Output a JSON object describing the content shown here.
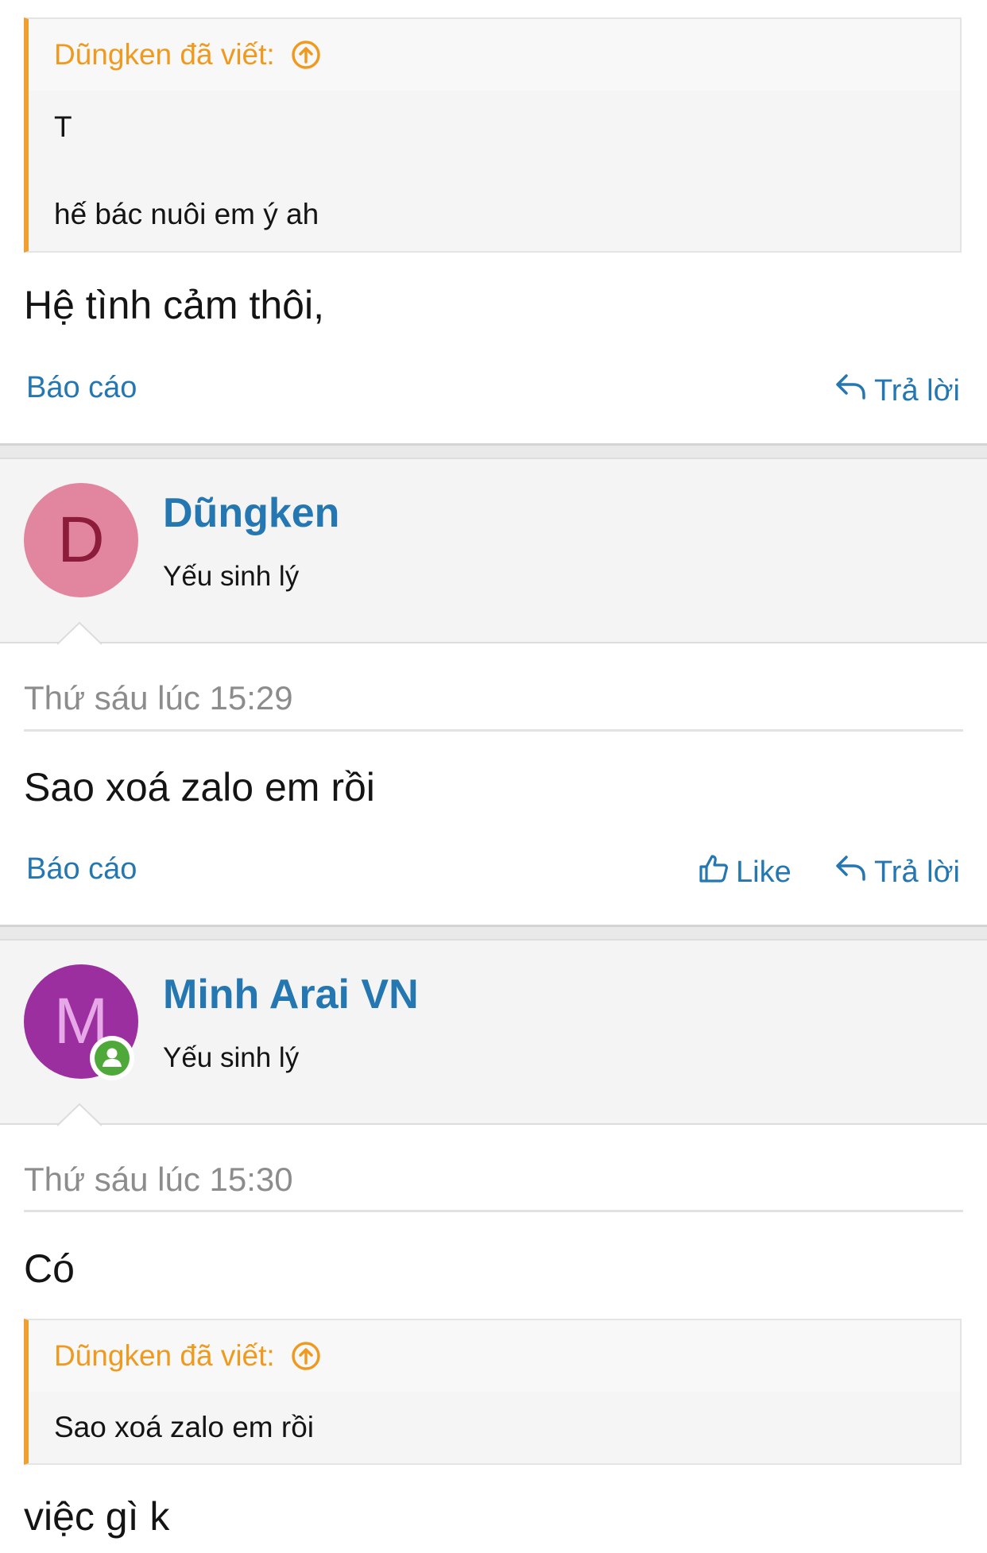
{
  "post_top": {
    "quote": {
      "header": "Dũngken đã viết:",
      "lines": [
        "T",
        "hế bác nuôi em ý ah"
      ]
    },
    "text": "Hệ tình cảm thôi,",
    "report_label": "Báo cáo",
    "reply_label": "Trả lời"
  },
  "post_2": {
    "avatar_letter": "D",
    "avatar_bg": "#e2869f",
    "avatar_fg": "#8c1c3a",
    "username": "Dũngken",
    "user_title": "Yếu sinh lý",
    "timestamp": "Thứ sáu lúc 15:29",
    "text": "Sao xoá zalo em rồi",
    "report_label": "Báo cáo",
    "like_label": "Like",
    "reply_label": "Trả lời"
  },
  "post_3": {
    "avatar_letter": "M",
    "avatar_bg": "#9c2fa0",
    "avatar_fg": "#e6a8e6",
    "online_color": "#4fa83a",
    "username": "Minh Arai VN",
    "user_title": "Yếu sinh lý",
    "timestamp": "Thứ sáu lúc 15:30",
    "text": "Có",
    "quote": {
      "header": "Dũngken đã viết:",
      "lines": [
        "Sao xoá zalo em rồi"
      ]
    },
    "text_after": "việc gì k"
  },
  "colors": {
    "link": "#2577b1",
    "quote_accent": "#f0a030"
  }
}
